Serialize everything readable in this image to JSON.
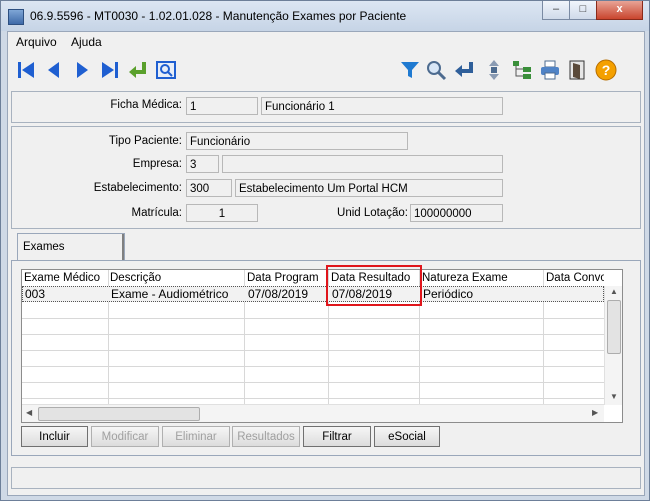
{
  "window": {
    "title": "06.9.5596 - MT0030 - 1.02.01.028 - Manutenção Exames por Paciente",
    "minimize": "–",
    "maximize": "□",
    "close": "x"
  },
  "menu": {
    "items": [
      "Arquivo",
      "Ajuda"
    ]
  },
  "toolbar": {
    "nav_icons": [
      "first-record-icon",
      "previous-record-icon",
      "next-record-icon",
      "last-record-icon",
      "return-icon",
      "zoom-icon"
    ],
    "tool_icons": [
      "filter-icon",
      "search-icon",
      "return-arrow-icon",
      "reorder-icon",
      "tree-icon",
      "print-icon",
      "exit-icon",
      "help-icon"
    ]
  },
  "header": {
    "ficha_label": "Ficha Médica:",
    "ficha_value": "1",
    "ficha_name": "Funcionário 1"
  },
  "details": {
    "tipo_label": "Tipo Paciente:",
    "tipo_value": "Funcionário",
    "empresa_label": "Empresa:",
    "empresa_value": "3",
    "empresa_name": "",
    "estab_label": "Estabelecimento:",
    "estab_value": "300",
    "estab_name": "Estabelecimento Um Portal HCM",
    "matricula_label": "Matrícula:",
    "matricula_value": "1",
    "lotacao_label": "Unid Lotação:",
    "lotacao_value": "100000000"
  },
  "tabs": [
    {
      "label": "Exames"
    }
  ],
  "grid": {
    "columns": [
      "Exame Médico",
      "Descrição",
      "Data Program",
      "Data Resultado",
      "Natureza Exame",
      "Data Convo"
    ],
    "rows": [
      [
        "003",
        "Exame - Audiométrico",
        "07/08/2019",
        "07/08/2019",
        "Periódico",
        ""
      ]
    ]
  },
  "buttons": {
    "incluir": "Incluir",
    "modificar": "Modificar",
    "eliminar": "Eliminar",
    "resultados": "Resultados",
    "filtrar": "Filtrar",
    "esocial": "eSocial"
  },
  "colors": {
    "highlight": "#e0151b",
    "nav_blue": "#1f5fd1",
    "help_orange": "#f4a000"
  }
}
